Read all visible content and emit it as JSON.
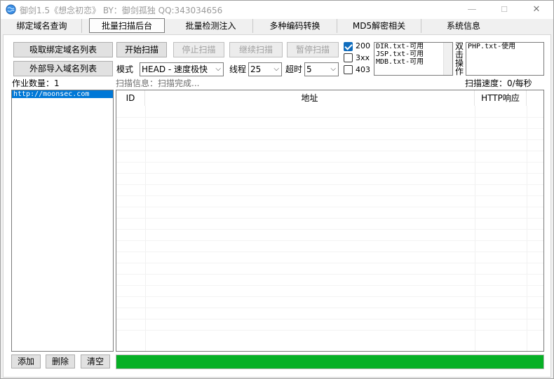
{
  "window": {
    "title": "御剑1.5《想念初恋》 BY：御剑孤独 QQ:343034656",
    "min": "—",
    "max": "☐",
    "close": "✕"
  },
  "tabs": [
    {
      "label": "绑定域名查询"
    },
    {
      "label": "批量扫描后台"
    },
    {
      "label": "批量检测注入"
    },
    {
      "label": "多种编码转换"
    },
    {
      "label": "MD5解密相关"
    },
    {
      "label": "系统信息"
    }
  ],
  "left": {
    "fetch_domains_button": "吸取绑定域名列表",
    "import_domains_button": "外部导入域名列表",
    "job_count": "作业数量：1",
    "domains": [
      "http://moonsec.com"
    ],
    "add_button": "添加",
    "delete_button": "删除",
    "clear_button": "清空"
  },
  "controls": {
    "start_button": "开始扫描",
    "stop_button": "停止扫描",
    "continue_button": "继续扫描",
    "pause_button": "暂停扫描",
    "mode_label": "模式",
    "mode_value": "HEAD - 速度极快",
    "threads_label": "线程",
    "threads_value": "25",
    "timeout_label": "超时",
    "timeout_value": "5",
    "status_200": "200",
    "status_3xx": "3xx",
    "status_403": "403",
    "dicts": [
      "DIR.txt-可用",
      "JSP.txt-可用",
      "MDB.txt-可用"
    ],
    "dblclick_label": [
      "双",
      "击",
      "操",
      "作"
    ],
    "dicts_used": [
      "PHP.txt-使用"
    ],
    "scan_info": "扫描信息：扫描完成...",
    "scan_speed": "扫描速度：0/每秒"
  },
  "results": {
    "columns": [
      "ID",
      "地址",
      "HTTP响应"
    ],
    "rows": []
  },
  "progress": {
    "value": 1.0,
    "color": "#06b025"
  },
  "colors": {
    "accent": "#0078d7",
    "check": "#0f6cbd"
  }
}
